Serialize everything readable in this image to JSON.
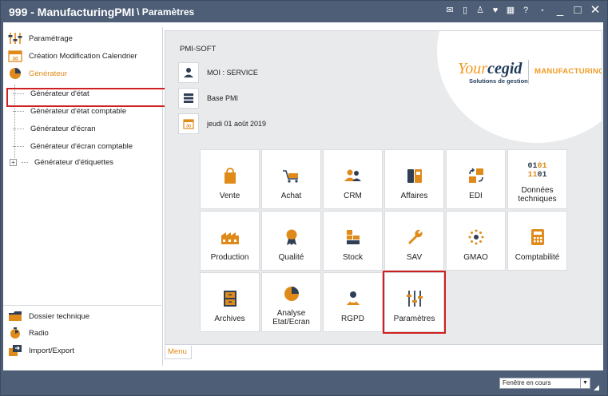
{
  "title": {
    "main": "999 - ManufacturingPMI",
    "sub": "\\ Paramètres"
  },
  "sidebar": {
    "top_items": [
      {
        "label": "Paramétrage",
        "icon": "sliders-icon"
      },
      {
        "label": "Création Modification Calendrier",
        "icon": "calendar-icon"
      },
      {
        "label": "Générateur",
        "icon": "pie-chart-icon"
      }
    ],
    "tree": [
      "Générateur d'état",
      "Générateur d'état comptable",
      "Générateur d'écran",
      "Générateur d'écran comptable",
      "Générateur d'étiquettes"
    ],
    "tree_expander": "+",
    "bottom_items": [
      {
        "label": "Dossier technique",
        "icon": "folder-icon"
      },
      {
        "label": "Radio",
        "icon": "radio-icon"
      },
      {
        "label": "Import/Export",
        "icon": "import-export-icon"
      }
    ]
  },
  "main": {
    "company": "PMI-SOFT",
    "info": [
      {
        "icon": "user-icon",
        "text": "MOI : SERVICE"
      },
      {
        "icon": "database-icon",
        "text": "Base PMI"
      },
      {
        "icon": "calendar-icon",
        "text": "jeudi 01 août 2019"
      }
    ],
    "logo": {
      "your": "Your",
      "cegid": "cegid",
      "tagline": "Solutions de gestion",
      "product": "MANUFACTURING"
    },
    "tiles": [
      {
        "label": "Vente",
        "icon": "bag-icon"
      },
      {
        "label": "Achat",
        "icon": "cart-icon"
      },
      {
        "label": "CRM",
        "icon": "people-icon"
      },
      {
        "label": "Affaires",
        "icon": "phone-icon"
      },
      {
        "label": "EDI",
        "icon": "exchange-icon"
      },
      {
        "label": "Données techniques",
        "icon": "binary-icon",
        "binary": "0101\n1101"
      },
      {
        "label": "Production",
        "icon": "factory-icon"
      },
      {
        "label": "Qualité",
        "icon": "medal-icon"
      },
      {
        "label": "Stock",
        "icon": "boxes-icon"
      },
      {
        "label": "SAV",
        "icon": "wrench-icon"
      },
      {
        "label": "GMAO",
        "icon": "gear-dots-icon"
      },
      {
        "label": "Comptabilité",
        "icon": "calculator-icon"
      },
      {
        "label": "Archives",
        "icon": "cabinet-icon"
      },
      {
        "label": "Analyse Etat/Ecran",
        "icon": "pie-chart-icon"
      },
      {
        "label": "RGPD",
        "icon": "person-badge-icon"
      },
      {
        "label": "Paramètres",
        "icon": "sliders-icon"
      }
    ],
    "menu_tab": "Menu"
  },
  "status": {
    "window_select": "Fenêtre en cours"
  },
  "colors": {
    "frame": "#4d5e76",
    "accent": "#f39a1f",
    "highlight": "#d11f1f"
  }
}
